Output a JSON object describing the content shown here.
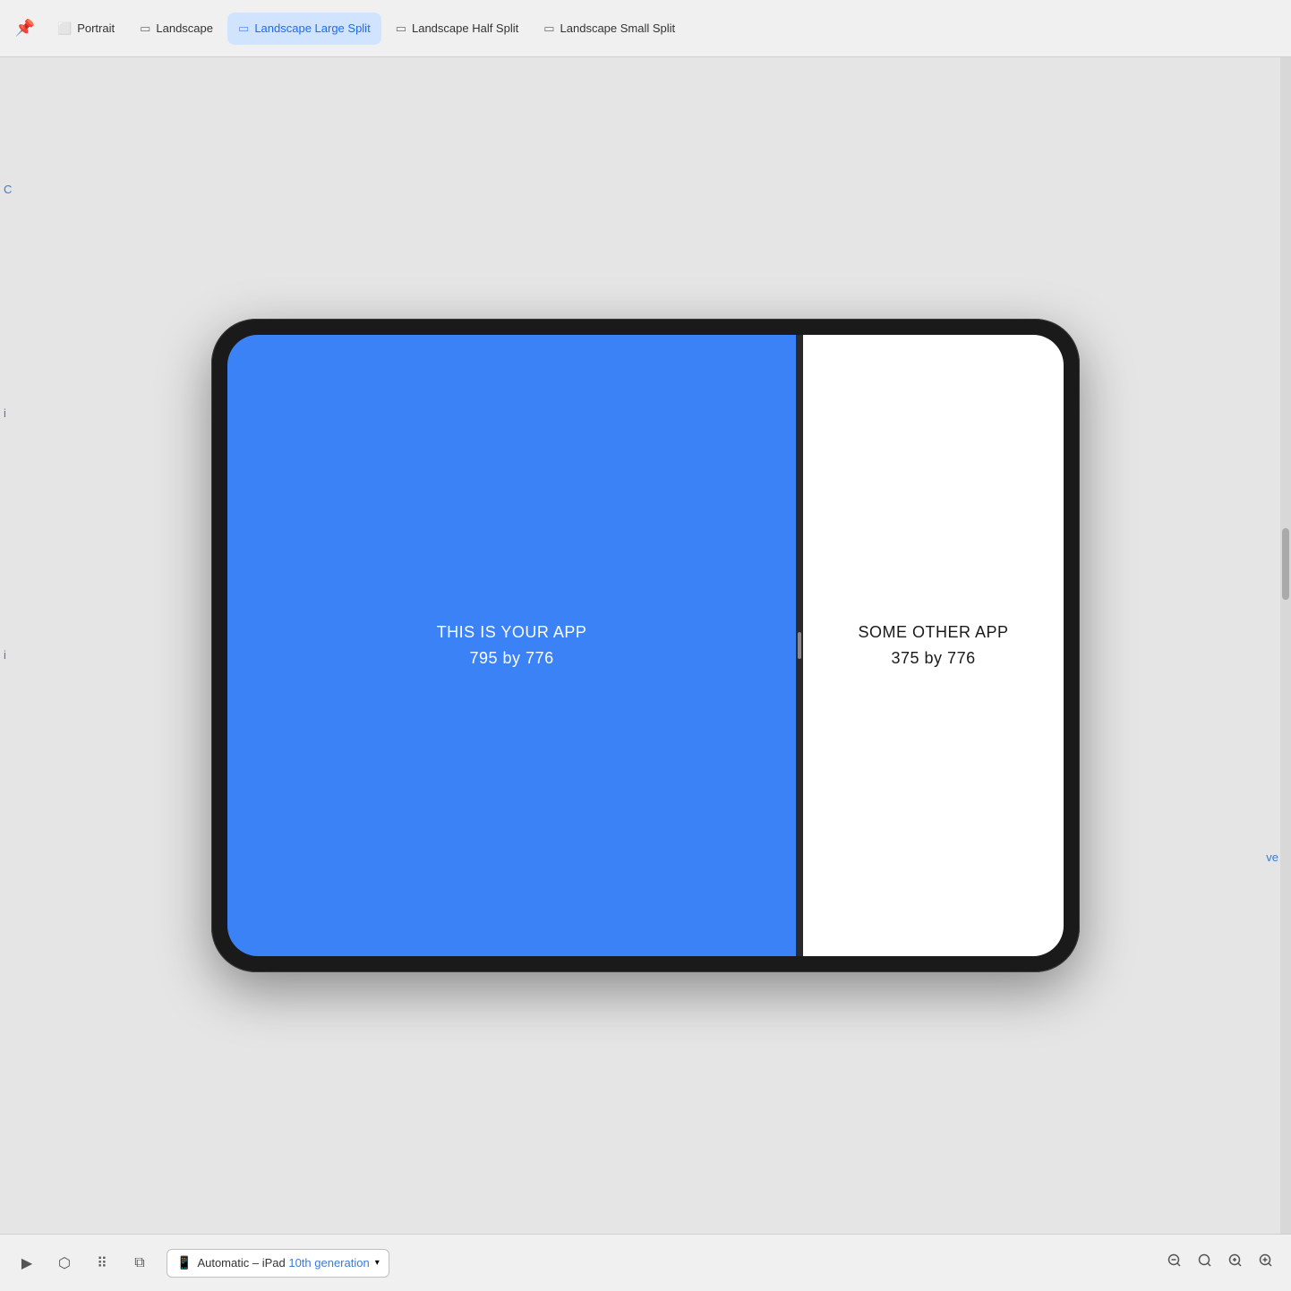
{
  "tabs": [
    {
      "id": "portrait",
      "label": "Portrait",
      "icon": "▭",
      "active": false
    },
    {
      "id": "landscape",
      "label": "Landscape",
      "icon": "▭",
      "active": false
    },
    {
      "id": "landscape-large-split",
      "label": "Landscape Large Split",
      "icon": "▭",
      "active": true
    },
    {
      "id": "landscape-half-split",
      "label": "Landscape Half Split",
      "icon": "▭",
      "active": false
    },
    {
      "id": "landscape-small-split",
      "label": "Landscape Small Split",
      "icon": "▭",
      "active": false
    }
  ],
  "ipad": {
    "main_app_label": "THIS IS YOUR APP",
    "main_app_size": "795 by 776",
    "secondary_app_label": "SOME OTHER APP",
    "secondary_app_size": "375 by 776"
  },
  "bottom_bar": {
    "play_icon": "▶",
    "cursor_icon": "⬡",
    "grid_icon": "⠿",
    "adjust_icon": "⧉",
    "device_label": "Automatic – iPad",
    "device_gen": "10th generation",
    "zoom_out_icon": "−",
    "zoom_fit_icon": "⊡",
    "zoom_reset_icon": "⊠",
    "zoom_in_icon": "+"
  },
  "sidebar": {
    "top_label": "c",
    "mid_label": "i",
    "low_label": "i",
    "right_label": "ve"
  },
  "colors": {
    "active_tab_bg": "#d0e4ff",
    "active_tab_text": "#1a6cf5",
    "main_app_bg": "#3b82f6",
    "secondary_app_bg": "#ffffff",
    "device_frame": "#1a1a1a"
  }
}
